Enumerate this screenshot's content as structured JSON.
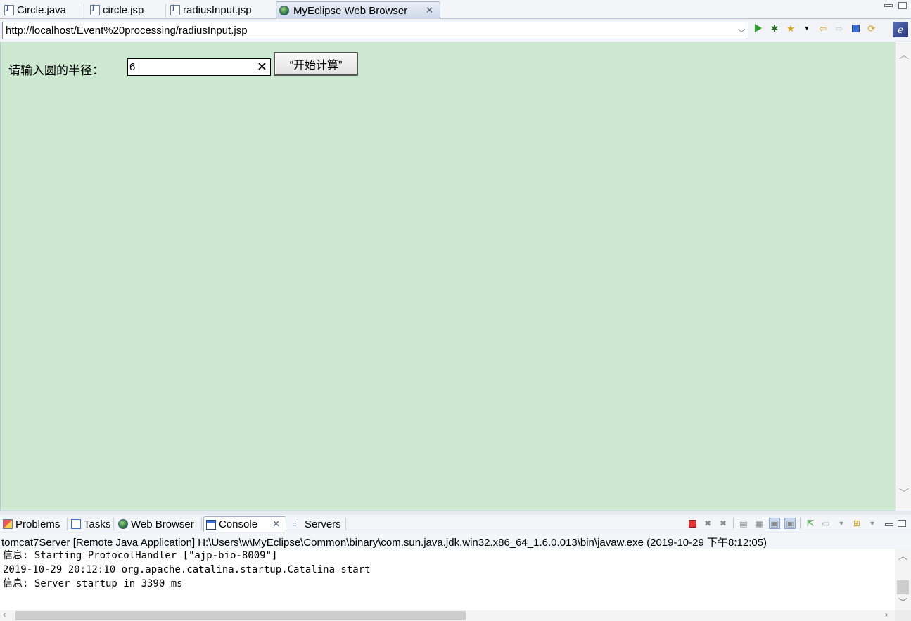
{
  "editor_tabs": [
    {
      "label": "Circle.java",
      "icon": "java-file-icon"
    },
    {
      "label": "circle.jsp",
      "icon": "jsp-file-icon"
    },
    {
      "label": "radiusInput.jsp",
      "icon": "jsp-file-icon"
    },
    {
      "label": "MyEclipse Web Browser",
      "icon": "globe-icon",
      "active": true,
      "close": "✕"
    }
  ],
  "browser": {
    "url": "http://localhost/Event%20processing/radiusInput.jsp",
    "toolbar_icons": [
      "go-icon",
      "debug-icon",
      "favorites-icon",
      "dropdown-icon",
      "back-icon",
      "forward-icon",
      "stop-icon",
      "refresh-icon",
      "myeclipse-logo-icon"
    ]
  },
  "page": {
    "background": "#cde8d1",
    "label": "请输入圆的半径：",
    "input_value": "6",
    "clear_glyph": "✕",
    "button_label": "“开始计算”"
  },
  "view_tabs": [
    {
      "label": "Problems",
      "icon": "problems-icon"
    },
    {
      "label": "Tasks",
      "icon": "tasks-icon"
    },
    {
      "label": "Web Browser",
      "icon": "globe-icon"
    },
    {
      "label": "Console",
      "icon": "console-icon",
      "active": true,
      "close": "✕"
    },
    {
      "label": "Servers",
      "icon": "servers-icon"
    }
  ],
  "console": {
    "description": "tomcat7Server [Remote Java Application] H:\\Users\\w\\MyEclipse\\Common\\binary\\com.sun.java.jdk.win32.x86_64_1.6.0.013\\bin\\javaw.exe (2019-10-29 下午8:12:05)",
    "lines": [
      "信息: Starting ProtocolHandler [\"ajp-bio-8009\"]",
      "2019-10-29 20:12:10 org.apache.catalina.startup.Catalina start",
      "信息: Server startup in 3390 ms"
    ]
  }
}
